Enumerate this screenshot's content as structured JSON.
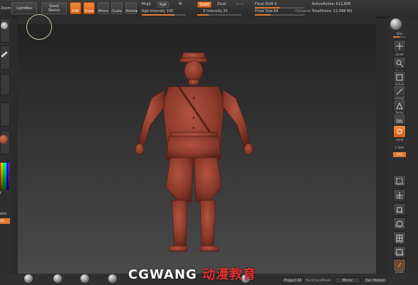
{
  "topbar": {
    "lightbox": "LightBox",
    "zoom": "Zoom",
    "quicksketch_line1": "Quick",
    "quicksketch_line2": "Sketch",
    "edit": "Edit",
    "draw": "Draw",
    "move": "Move",
    "scale": "Scale",
    "rotate": "Rotate",
    "mrgb": "Mrgb",
    "rgb": "Rgb",
    "m": "M",
    "rgb_intensity_label": "Rgb Intensity 100",
    "zadd": "Zadd",
    "zsub": "Zsub",
    "zcut": "Zcut",
    "z_intensity_label": "Z Intensity 25",
    "focal_shift_label": "Focal Shift 0",
    "draw_size_label": "Draw Size 64",
    "dynamic": "Dynamic",
    "active_points": "ActivePoints: 612,806",
    "total_points": "TotalPoints: 12.098 Mil"
  },
  "rightpanel": {
    "spix": "SPix",
    "scroll": "Scroll",
    "zoom": "Zoom",
    "actual": "Actual",
    "aahalf": "AAHalf",
    "persp": "Persp",
    "floor": "Floor",
    "local": "Local",
    "lsym": "L.Sym",
    "xyz": "XYZ",
    "frame": "Frame",
    "move": "Move",
    "scale": "Scale",
    "rotate": "Rotate",
    "polyf": "PolyF",
    "transp": "Transp",
    "ghost": "Ghost"
  },
  "bottombar": {
    "backface_mask": "BackfaceMask",
    "project_all": "Project All",
    "mirror": "Mirror",
    "del_hidden": "Del Hidden"
  },
  "leftpanel": {
    "color_label": "olor",
    "swatch_label": "ch"
  },
  "watermark": {
    "latin": "CGWANG",
    "chinese": "动漫教育"
  },
  "colors": {
    "accent": "#e07a2f",
    "model": "#8c3a2c",
    "watermark_cn": "#e03030"
  }
}
